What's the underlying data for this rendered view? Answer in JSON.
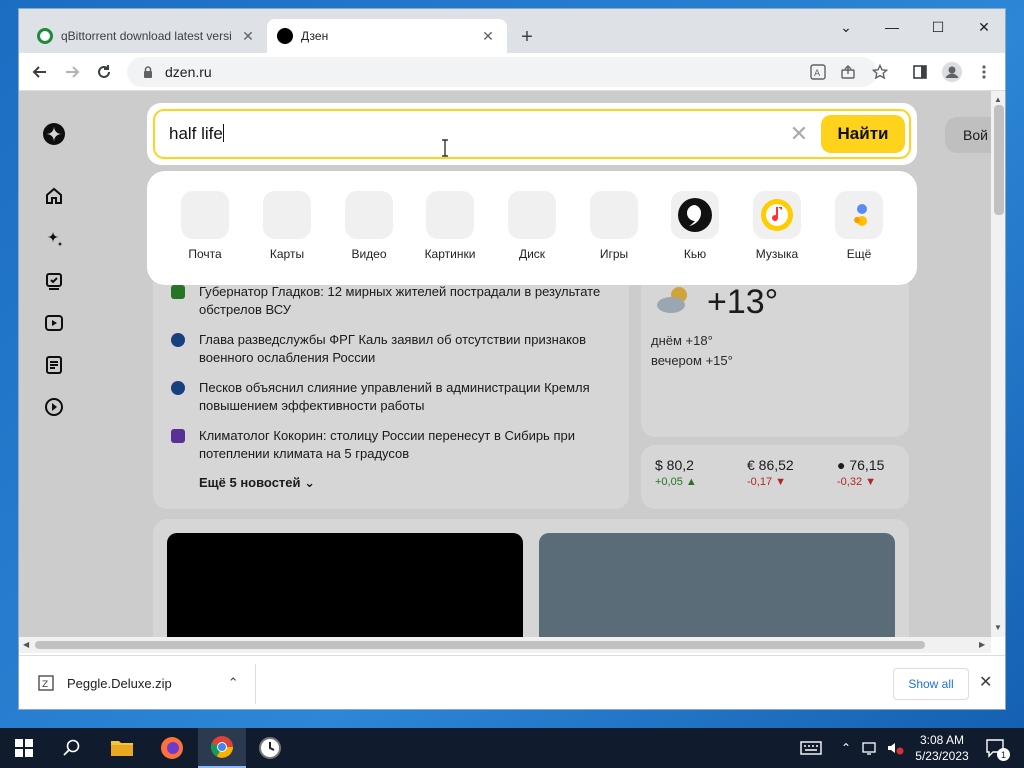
{
  "tabs": [
    {
      "title": "qBittorrent download latest versi",
      "close": "✕"
    },
    {
      "title": "Дзен",
      "close": "✕"
    }
  ],
  "window_controls": {
    "minimize": "⌄",
    "restore": "—",
    "maximize": "☐",
    "close": "✕"
  },
  "newtab_label": "+",
  "address": "dzen.ru",
  "search": {
    "query": "half life",
    "find_label": "Найти",
    "clear": "✕"
  },
  "login_label": "Вой",
  "services": [
    {
      "label": "Почта",
      "icon": "mail-icon"
    },
    {
      "label": "Карты",
      "icon": "maps-icon"
    },
    {
      "label": "Видео",
      "icon": "video-icon"
    },
    {
      "label": "Картинки",
      "icon": "images-icon"
    },
    {
      "label": "Диск",
      "icon": "disk-icon"
    },
    {
      "label": "Игры",
      "icon": "games-icon"
    },
    {
      "label": "Кью",
      "icon": "q-icon"
    },
    {
      "label": "Музыка",
      "icon": "music-icon"
    },
    {
      "label": "Ещё",
      "icon": "more-icon"
    }
  ],
  "news": [
    {
      "text": "Губернатор Гладков: 12 мирных жителей пострадали в результате обстрелов ВСУ",
      "color": "#2e8b2e"
    },
    {
      "text": "Глава разведслужбы ФРГ Каль заявил об отсутствии признаков военного ослабления России",
      "color": "#1d4d9a"
    },
    {
      "text": "Песков объяснил слияние управлений в администрации Кремля повышением эффективности работы",
      "color": "#1d4d9a"
    },
    {
      "text": "Климатолог Кокорин: столицу России перенесут в Сибирь при потеплении климата на 5 градусов",
      "color": "#6a3ab0"
    }
  ],
  "news_more": "Ещё 5 новостей",
  "weather": {
    "temp": "+13°",
    "day": "днём +18°",
    "evening": "вечером +15°"
  },
  "rates": [
    {
      "value": "$ 80,2",
      "change": "+0,05",
      "dir": "up"
    },
    {
      "value": "€ 86,52",
      "change": "-0,17",
      "dir": "down"
    },
    {
      "value": "76,15",
      "change": "-0,32",
      "dir": "down"
    }
  ],
  "download": {
    "file": "Peggle.Deluxe.zip",
    "show_all": "Show all",
    "close": "✕"
  },
  "clock": {
    "time": "3:08 AM",
    "date": "5/23/2023"
  },
  "notification_count": "1",
  "colors": {
    "accent_yellow": "#ffd21c",
    "up": "#2e8b2e",
    "down": "#d0312d"
  }
}
